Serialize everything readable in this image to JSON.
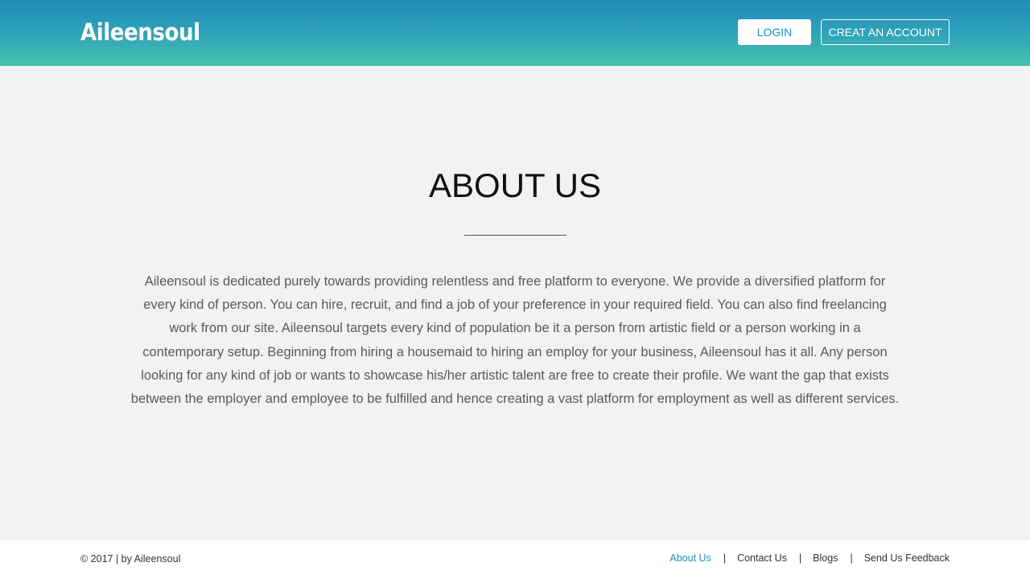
{
  "header": {
    "logo": "Aileensoul",
    "login_label": "LOGIN",
    "create_account_label": "CREAT AN ACCOUNT"
  },
  "main": {
    "title": "ABOUT US",
    "body": "Aileensoul is dedicated purely towards providing relentless and free platform to everyone. We provide a diversified platform for every kind of person. You can hire, recruit, and find a job of your preference in your required field. You can also find freelancing work from our site. Aileensoul targets every kind of population be it a person from artistic field or a person working in a contemporary setup. Beginning from hiring a housemaid to hiring an employ for your business, Aileensoul has it all. Any person looking for any kind of job or wants to showcase his/her artistic talent are free to create their profile. We want the gap that exists between the employer and employee to be fulfilled and hence creating a vast platform for employment as well as different services."
  },
  "footer": {
    "copyright": "© 2017 | by Aileensoul",
    "separator": "|",
    "links": [
      {
        "label": "About Us",
        "active": true
      },
      {
        "label": "Contact Us",
        "active": false
      },
      {
        "label": "Blogs",
        "active": false
      },
      {
        "label": "Send Us Feedback",
        "active": false
      }
    ]
  },
  "colors": {
    "header_gradient_top": "#1e8cbb",
    "header_gradient_bottom": "#47c2ae",
    "accent": "#1f8fc0",
    "page_background": "#f2f2f1"
  }
}
